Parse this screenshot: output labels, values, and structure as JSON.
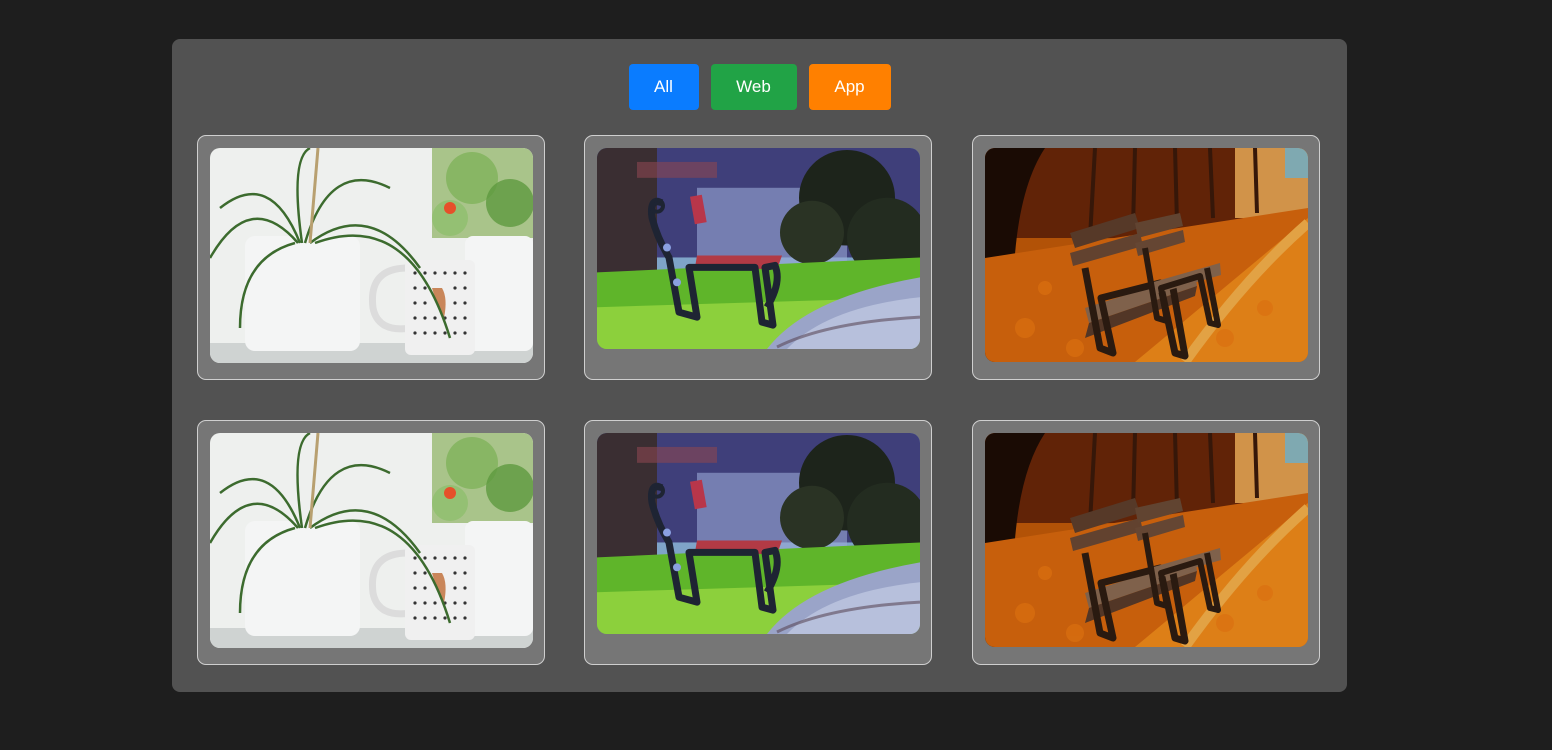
{
  "filters": [
    {
      "label": "All",
      "color": "#0a7cff"
    },
    {
      "label": "Web",
      "color": "#21a346"
    },
    {
      "label": "App",
      "color": "#ff8000"
    }
  ],
  "gallery": {
    "items": [
      {
        "image": "plants-and-mug-photo",
        "category": "row-1"
      },
      {
        "image": "park-bench-photo",
        "category": "row-1"
      },
      {
        "image": "autumn-benches-photo",
        "category": "row-1"
      },
      {
        "image": "plants-and-mug-photo",
        "category": "row-2"
      },
      {
        "image": "park-bench-photo",
        "category": "row-2"
      },
      {
        "image": "autumn-benches-photo",
        "category": "row-2"
      }
    ]
  },
  "colors": {
    "page_background": "#1e1e1e",
    "panel_background": "#525252",
    "card_background": "#767676",
    "card_border": "#cfcfcf"
  }
}
